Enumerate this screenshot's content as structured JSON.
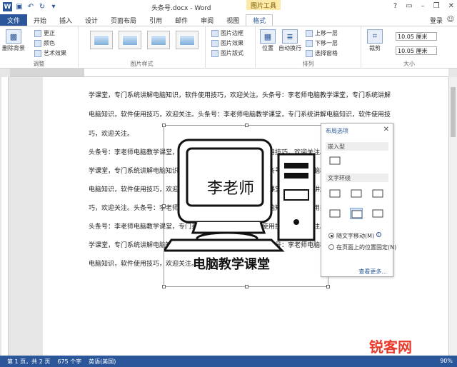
{
  "title_bar": {
    "doc_title": "头条号.docx - Word",
    "tools_label": "图片工具",
    "login": "登录"
  },
  "tabs": [
    "文件",
    "开始",
    "插入",
    "设计",
    "页面布局",
    "引用",
    "邮件",
    "审阅",
    "视图",
    "格式"
  ],
  "ribbon": {
    "remove_bg": "删除背景",
    "corrections": "更正",
    "color": "颜色",
    "artistic": "艺术效果",
    "adjust_label": "调整",
    "styles_label": "图片样式",
    "border": "图片边框",
    "effects": "图片效果",
    "layout": "图片版式",
    "position": "位置",
    "wrap_text": "自动换行",
    "bring_forward": "上移一层",
    "send_backward": "下移一层",
    "selection_pane": "选择窗格",
    "arrange_label": "排列",
    "crop": "裁剪",
    "height": "10.05 厘米",
    "width": "10.05 厘米",
    "size_label": "大小"
  },
  "document": {
    "lines": [
      "学课堂，专门系统讲解电脑知识，软件使用技巧，欢迎关注。头条号：李老师电脑教学课堂，专门系统讲解",
      "电脑知识，软件使用技巧，欢迎关注。头条号：李老师电脑教学课堂，专门系统讲解电脑知识，软件使用技",
      "巧，欢迎关注。",
      "头条号：李老师电脑教学课堂，专门系统讲解电脑知识，软件使用技巧，欢迎关注。头条号：",
      "学课堂，专门系统讲解电脑知识，软件使用技巧，欢迎关注。头条号：李老师电脑教学课堂，专门系统讲解",
      "电脑知识，软件使用技巧，欢迎关注。头条号：李老师电脑教学课堂，专门系统讲解电脑知识，软件使用技",
      "巧，欢迎关注。头条号：李老师电脑教学课堂，专门系统讲解电脑知识，软件使用技巧，欢迎关注。",
      "头条号：李老师电脑教学课堂，专门系统讲解电脑知识，软件使用技巧，欢迎关注。头条号：李老师电脑教",
      "学课堂，专门系统讲解电脑知识，软件使用技巧，欢迎关注。头条号：李老师电脑教学课堂，专门系统讲解",
      "电脑知识，软件使用技巧，欢迎关注。"
    ],
    "picture_caption": "电脑教学课堂",
    "picture_name": "李老师"
  },
  "layout_panel": {
    "title": "布局选项",
    "inline_section": "嵌入型",
    "wrap_section": "文字环绕",
    "move_with_text": "随文字移动(M)",
    "fix_position": "在页面上的位置固定(N)",
    "see_more": "查看更多..."
  },
  "status_bar": {
    "page": "第 1 页，共 2 页",
    "words": "675 个字",
    "language": "英语(美国)",
    "zoom": "90%"
  },
  "watermark": "锐客网"
}
